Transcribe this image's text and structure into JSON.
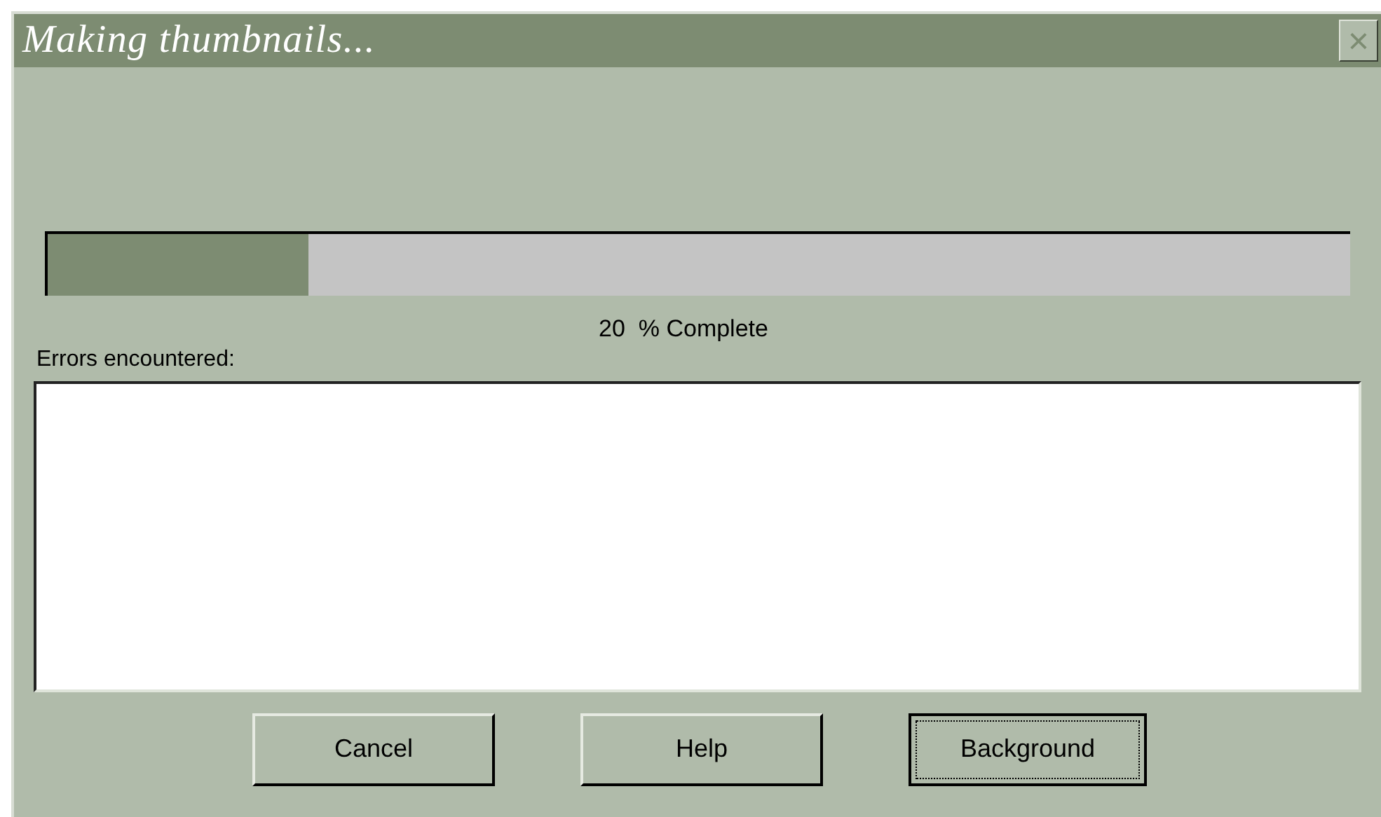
{
  "window": {
    "title": "Making thumbnails...",
    "close": "×"
  },
  "progress": {
    "level": 0.2,
    "reading": "20  % Complete"
  },
  "errors": {
    "label": "Errors encountered:"
  },
  "buttons": [
    {
      "label": "Cancel",
      "default": false
    },
    {
      "label": "Help",
      "default": false
    },
    {
      "label": "Background",
      "default": true
    }
  ]
}
